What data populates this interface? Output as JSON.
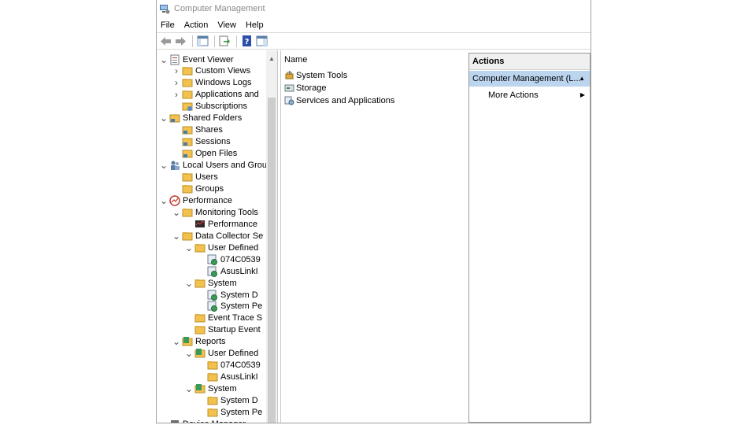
{
  "window": {
    "title": "Computer Management"
  },
  "menu": [
    "File",
    "Action",
    "View",
    "Help"
  ],
  "toolbar": [
    {
      "name": "back-icon"
    },
    {
      "name": "forward-icon"
    },
    {
      "name": "show-hide-console-tree-icon"
    },
    {
      "name": "export-list-icon"
    },
    {
      "name": "help-icon"
    },
    {
      "name": "show-hide-action-pane-icon"
    }
  ],
  "tree": [
    {
      "label": "Event Viewer",
      "depth": 1,
      "expander": "open",
      "icon": "event-viewer-icon"
    },
    {
      "label": "Custom Views",
      "depth": 2,
      "expander": "closed",
      "icon": "folder-icon"
    },
    {
      "label": "Windows Logs",
      "depth": 2,
      "expander": "closed",
      "icon": "folder-icon"
    },
    {
      "label": "Applications and",
      "depth": 2,
      "expander": "closed",
      "icon": "folder-icon"
    },
    {
      "label": "Subscriptions",
      "depth": 2,
      "expander": "none",
      "icon": "subscriptions-icon"
    },
    {
      "label": "Shared Folders",
      "depth": 1,
      "expander": "open",
      "icon": "shared-folder-icon"
    },
    {
      "label": "Shares",
      "depth": 2,
      "expander": "none",
      "icon": "shared-folder-icon"
    },
    {
      "label": "Sessions",
      "depth": 2,
      "expander": "none",
      "icon": "shared-folder-icon"
    },
    {
      "label": "Open Files",
      "depth": 2,
      "expander": "none",
      "icon": "shared-folder-icon"
    },
    {
      "label": "Local Users and Grou",
      "depth": 1,
      "expander": "open",
      "icon": "users-icon"
    },
    {
      "label": "Users",
      "depth": 2,
      "expander": "none",
      "icon": "folder-icon"
    },
    {
      "label": "Groups",
      "depth": 2,
      "expander": "none",
      "icon": "folder-icon"
    },
    {
      "label": "Performance",
      "depth": 1,
      "expander": "open",
      "icon": "performance-icon"
    },
    {
      "label": "Monitoring Tools",
      "depth": 2,
      "expander": "open",
      "icon": "folder-icon"
    },
    {
      "label": "Performance",
      "depth": 3,
      "expander": "none",
      "icon": "monitor-icon"
    },
    {
      "label": "Data Collector Se",
      "depth": 2,
      "expander": "open",
      "icon": "folder-icon"
    },
    {
      "label": "User Defined",
      "depth": 3,
      "expander": "open",
      "icon": "folder-icon"
    },
    {
      "label": "074C0539",
      "depth": 4,
      "expander": "none",
      "icon": "collector-set-icon"
    },
    {
      "label": "AsusLinkI",
      "depth": 4,
      "expander": "none",
      "icon": "collector-set-icon"
    },
    {
      "label": "System",
      "depth": 3,
      "expander": "open",
      "icon": "folder-icon"
    },
    {
      "label": "System D",
      "depth": 4,
      "expander": "none",
      "icon": "collector-set-icon"
    },
    {
      "label": "System Pe",
      "depth": 4,
      "expander": "none",
      "icon": "collector-set-icon"
    },
    {
      "label": "Event Trace S",
      "depth": 3,
      "expander": "none",
      "icon": "folder-icon"
    },
    {
      "label": "Startup Event",
      "depth": 3,
      "expander": "none",
      "icon": "folder-icon"
    },
    {
      "label": "Reports",
      "depth": 2,
      "expander": "open",
      "icon": "report-icon"
    },
    {
      "label": "User Defined",
      "depth": 3,
      "expander": "open",
      "icon": "report-icon"
    },
    {
      "label": "074C0539",
      "depth": 4,
      "expander": "none",
      "icon": "folder-icon"
    },
    {
      "label": "AsusLinkI",
      "depth": 4,
      "expander": "none",
      "icon": "folder-icon"
    },
    {
      "label": "System",
      "depth": 3,
      "expander": "open",
      "icon": "report-icon"
    },
    {
      "label": "System D",
      "depth": 4,
      "expander": "none",
      "icon": "folder-icon"
    },
    {
      "label": "System Pe",
      "depth": 4,
      "expander": "none",
      "icon": "folder-icon"
    },
    {
      "label": "Device Manager",
      "depth": 1,
      "expander": "none",
      "icon": "device-manager-icon"
    }
  ],
  "content": {
    "column_header": "Name",
    "items": [
      {
        "label": "System Tools",
        "icon": "system-tools-icon"
      },
      {
        "label": "Storage",
        "icon": "storage-icon"
      },
      {
        "label": "Services and Applications",
        "icon": "services-icon"
      }
    ]
  },
  "actions": {
    "header": "Actions",
    "selected": "Computer Management (L...",
    "more": "More Actions"
  },
  "colors": {
    "selection": "#bcd5ee",
    "folder": "#f2c14e"
  }
}
